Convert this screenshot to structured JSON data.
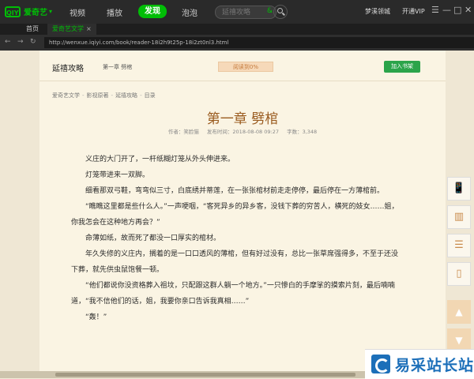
{
  "app": {
    "logo_text": "爱奇艺",
    "logo_badge": "QIYI",
    "nav": [
      "视频",
      "播放",
      "发现",
      "泡泡"
    ],
    "active_nav": "发现",
    "search": {
      "placeholder": "延禧攻略",
      "suffix": "&"
    },
    "user": "梦溪领城",
    "vip": "开通VIP",
    "window_buttons": [
      "☰",
      "—",
      "□",
      "✕"
    ]
  },
  "tabs": {
    "home": "首页",
    "active": "爱奇艺文学",
    "close": "×"
  },
  "address": {
    "url": "http://wenxue.iqiyi.com/book/reader-18i2h9t25p-18i2zt0nl3.html"
  },
  "book": {
    "title": "延禧攻略",
    "chapter_short": "第一章 劈棺",
    "progress": "阅读到0%",
    "add_shelf": "加入书架"
  },
  "breadcrumb": [
    "爱奇艺文学",
    "影视原著",
    "延禧攻略",
    "目录"
  ],
  "chapter": {
    "title": "第一章 劈棺",
    "author": "作者：笑脸猫",
    "published": "发布时间：2018-08-08 09:27",
    "word_count": "字数：3,348"
  },
  "paragraphs": [
    "义庄的大门开了，一杆纸糊灯笼从外头伸进来。",
    "灯笼带进来一双脚。",
    "细看那双弓鞋，弯弯似三寸，白底绣并蒂莲，在一张张棺材前走走停停，最后停在一方薄棺前。",
    "“瞧瞧这里都是些什么人。”一声哽咽，“客死异乡的异乡客，没钱下葬的穷苦人，横死的妓女……姐，你我怎会在这种地方再会？”",
    "命薄如纸，故而死了都没一口厚实的棺材。",
    "年久失修的义庄内，搁着的是一口口透风的薄棺，但有好过没有，总比一张草席强得多，不至于还没下葬，就先供虫鼠饱餐一顿。",
    "“他们都说你没资格葬入祖坟，只配跟这群人躺一个地方。”一只惨白的手摩挲的摸索片刻，最后喃喃道，“我不信他们的话，姐，我要你亲口告诉我真相……”",
    "“轰！”"
  ],
  "side_tools": [
    "📱",
    "▥",
    "☰",
    "▯"
  ],
  "scroll_buttons": [
    "▲",
    "▼"
  ],
  "watermark": {
    "text": "易采站长站"
  }
}
